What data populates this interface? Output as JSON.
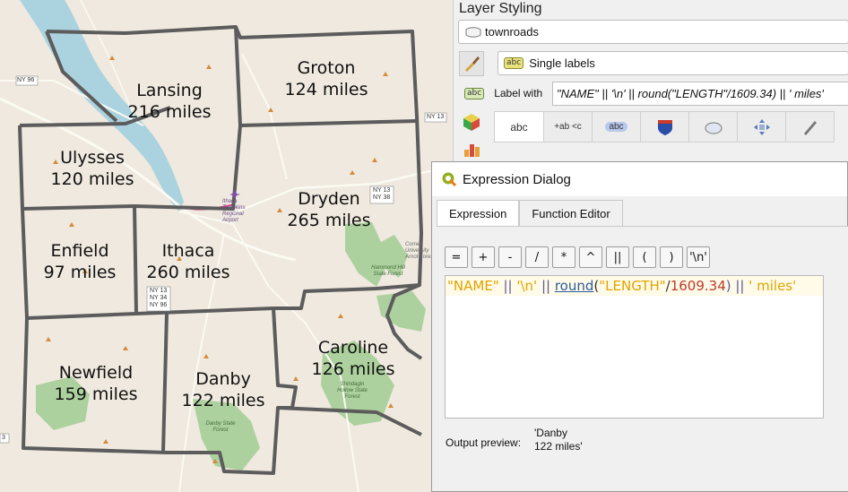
{
  "map": {
    "towns": [
      {
        "name": "Lansing",
        "miles": "216 miles"
      },
      {
        "name": "Groton",
        "miles": "124 miles"
      },
      {
        "name": "Ulysses",
        "miles": "120 miles"
      },
      {
        "name": "Dryden",
        "miles": "265 miles"
      },
      {
        "name": "Enfield",
        "miles": "97 miles"
      },
      {
        "name": "Ithaca",
        "miles": "260 miles"
      },
      {
        "name": "Caroline",
        "miles": "126 miles"
      },
      {
        "name": "Newfield",
        "miles": "159 miles"
      },
      {
        "name": "Danby",
        "miles": "122 miles"
      }
    ],
    "shields": {
      "ny96": "NY 96",
      "ny13": "NY 13",
      "ny13_38_a": "NY 13",
      "ny13_38_b": "NY 38",
      "ny13_34_96_a": "NY 13",
      "ny13_34_96_b": "NY 34",
      "ny13_34_96_c": "NY 96",
      "edge3": "3"
    },
    "small_labels": {
      "airport": "Ithaca Tompkins Regional Airport",
      "hammond": "Hammond Hill State Forest",
      "shindagin": "Shindagin Hollow State Forest",
      "danby_forest": "Danby State Forest",
      "cornell": "Cornell University Arnot Forest"
    },
    "colors": {
      "land": "#efe9df",
      "lake": "#aad3df",
      "forest": "#add19e",
      "boundary": "#5c5c5c",
      "road": "#f7f4ea"
    }
  },
  "styling": {
    "title": "Layer Styling",
    "layer": "townroads",
    "label_mode": "Single labels",
    "label_with": "Label with",
    "expression": "\"NAME\" || '\\n' || round(\"LENGTH\"/1609.34) || ' miles'",
    "tabs": [
      "abc",
      "+ab <c",
      "abc",
      "shield-icon",
      "background-icon",
      "placement-icon",
      "rendering-icon"
    ]
  },
  "dialog": {
    "title": "Expression Dialog",
    "tabs": {
      "expression": "Expression",
      "function_editor": "Function Editor"
    },
    "operators": [
      "=",
      "+",
      "-",
      "/",
      "*",
      "^",
      "||",
      "(",
      ")",
      "'\\n'"
    ],
    "code": {
      "t1": "\"NAME\"",
      "t2": " || ",
      "t3": "'\\n'",
      "t4": " || ",
      "t5": "round",
      "t6": "(",
      "t7": "\"LENGTH\"",
      "t8": "/",
      "t9": "1609.34",
      "t10": ") || ",
      "t11": "' miles'"
    },
    "preview_label": "Output preview:",
    "preview_value": "'Danby\n122 miles'"
  }
}
